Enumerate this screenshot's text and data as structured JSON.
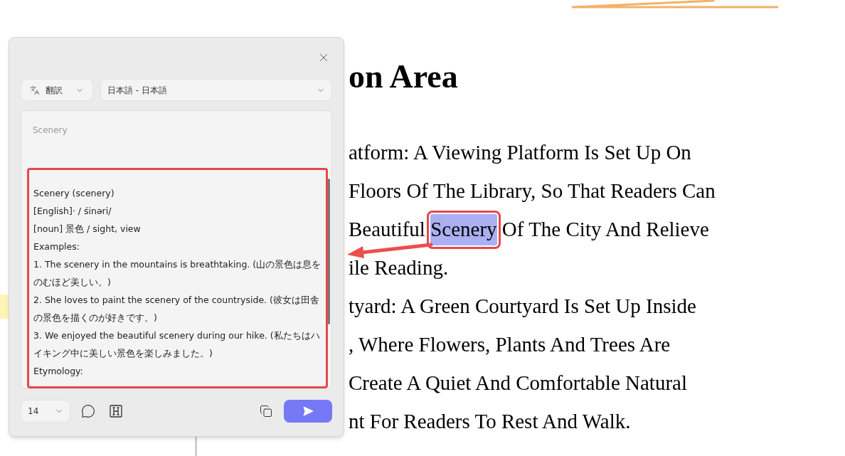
{
  "document": {
    "title": "on Area",
    "lines": [
      {
        "segments": [
          {
            "text": "atform: A Viewing Platform Is Set Up On",
            "selected": false
          }
        ]
      },
      {
        "segments": [
          {
            "text": "Floors Of The Library, So That Readers Can",
            "selected": false
          }
        ]
      },
      {
        "segments": [
          {
            "text": "Beautiful ",
            "selected": false
          },
          {
            "text": "Scenery",
            "selected": true
          },
          {
            "text": " Of The City And Relieve",
            "selected": false
          }
        ]
      },
      {
        "segments": [
          {
            "text": "ile Reading.",
            "selected": false
          }
        ]
      },
      {
        "left_highlighted": true,
        "segments": [
          {
            "text": "tyard: A Green Courtyard Is Set Up Inside",
            "selected": false
          }
        ]
      },
      {
        "segments": [
          {
            "text": ", Where Flowers, Plants And Trees Are",
            "selected": false
          }
        ]
      },
      {
        "segments": [
          {
            "text": "Create A Quiet And Comfortable Natural",
            "selected": false
          }
        ]
      },
      {
        "segments": [
          {
            "text": "nt For Readers To Rest And Walk.",
            "selected": false
          }
        ]
      }
    ]
  },
  "panel": {
    "mode": "翻訳",
    "language": "日本語 - 日本語",
    "source": "Scenery",
    "result": [
      "Scenery (scenery)",
      "[English]· / śinəri/",
      "[noun] 景色 / sight, view",
      "Examples:",
      "1. The scenery in the mountains is breathtaking. (山の景色は息をのむほど美しい。)",
      "2. She loves to paint the scenery of the countryside. (彼女は田舎の景色を描くのが好きです。)",
      "3. We enjoyed the beautiful scenery during our hike. (私たちはハイキング中に美しい景色を楽しみました。)",
      "Etymology:"
    ],
    "font_size": "14"
  }
}
